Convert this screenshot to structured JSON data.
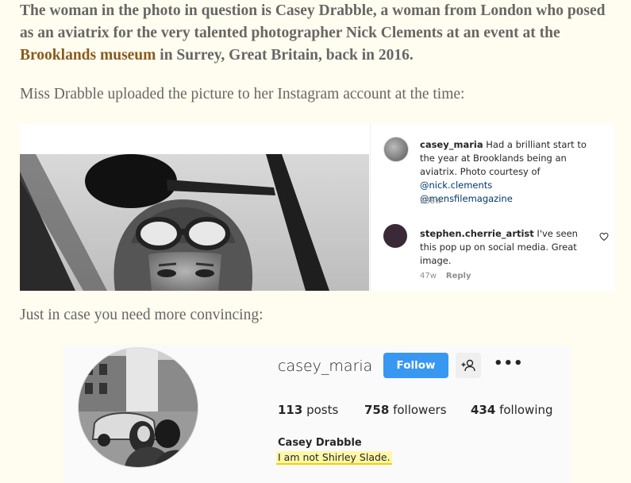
{
  "article": {
    "p1_part1": "The woman in the photo in question is Casey Drabble, a woman from London who posed as an aviatrix for the very talented photographer Nick Clements at an event at the ",
    "p1_link": "Brooklands museum",
    "p1_part2": " in Surrey, Great Britain, back in 2016.",
    "p2": "Miss Drabble uploaded the picture to her Instagram account at the time:",
    "p3": "Just in case you need more convincing:"
  },
  "post": {
    "comments": [
      {
        "username": "casey_maria",
        "text": " Had a brilliant start to the year at Brooklands being an aviatrix. Photo courtesy of ",
        "mention1": "@nick.clements",
        "mention2": "@mensfilemagazine",
        "age": "368w"
      },
      {
        "username": "stephen.cherrie_artist",
        "text": " I've seen this pop up on social media. Great image.",
        "age": "47w",
        "reply": "Reply"
      }
    ],
    "heart_icon": "heart-outline-icon"
  },
  "profile": {
    "username": "casey_maria",
    "follow_label": "Follow",
    "add_user_icon": "add-user-icon",
    "more_icon": "more-horizontal-icon",
    "more_label": "•••",
    "posts_count": "113",
    "posts_label": " posts",
    "followers_count": "758",
    "followers_label": " followers",
    "following_count": "434",
    "following_label": " following",
    "full_name": "Casey Drabble",
    "bio": "I am not Shirley Slade."
  },
  "colors": {
    "page_bg": "#fffdf0",
    "link": "#8b5a1e",
    "follow_button": "#3897f0",
    "highlight": "#fff7a8"
  }
}
